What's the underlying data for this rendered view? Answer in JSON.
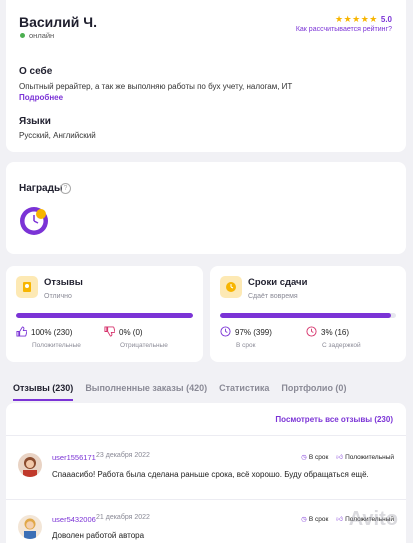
{
  "profile": {
    "name": "Василий Ч.",
    "status": "онлайн",
    "rating_stars": "★★★★★",
    "rating_value": "5.0",
    "rating_link": "Как рассчитывается рейтинг?",
    "about_heading": "О себе",
    "about_text": "Опытный рерайтер, а так же выполняю работы по бух учету, налогам, ИТ",
    "about_more": "Подробнее",
    "languages_heading": "Языки",
    "languages": "Русский, Английский"
  },
  "awards": {
    "heading": "Награды"
  },
  "stats": {
    "reviews": {
      "title": "Отзывы",
      "subtitle": "Отлично",
      "bar_fraction": 1.0,
      "positive_value": "100% (230)",
      "positive_label": "Положительные",
      "negative_value": "0% (0)",
      "negative_label": "Отрицательные"
    },
    "deadlines": {
      "title": "Сроки сдачи",
      "subtitle": "Сдаёт вовремя",
      "bar_fraction": 0.97,
      "ontime_value": "97% (399)",
      "ontime_label": "В срок",
      "late_value": "3% (16)",
      "late_label": "С задержкой"
    }
  },
  "tabs": [
    {
      "label": "Отзывы (230)",
      "active": true
    },
    {
      "label": "Выполненные заказы (420)",
      "active": false
    },
    {
      "label": "Статистика",
      "active": false
    },
    {
      "label": "Портфолио (0)",
      "active": false
    }
  ],
  "reviews_list": {
    "see_all": "Посмотреть все отзывы (230)",
    "items": [
      {
        "user": "user1556171",
        "date": "23 декабря 2022",
        "badge_time": "В срок",
        "badge_sentiment": "Положительный",
        "text": "Спааасибо! Работа была сделана раньше срока, всё хорошо. Буду обращаться ещё."
      },
      {
        "user": "user5432006",
        "date": "21 декабря 2022",
        "badge_time": "В срок",
        "badge_sentiment": "Положительный",
        "text": "Доволен работой автора"
      }
    ]
  },
  "watermark": "Avito",
  "colors": {
    "accent": "#7b33d6",
    "star": "#f7b500",
    "online": "#4caf50",
    "icon_bg": "#fde9b4"
  }
}
